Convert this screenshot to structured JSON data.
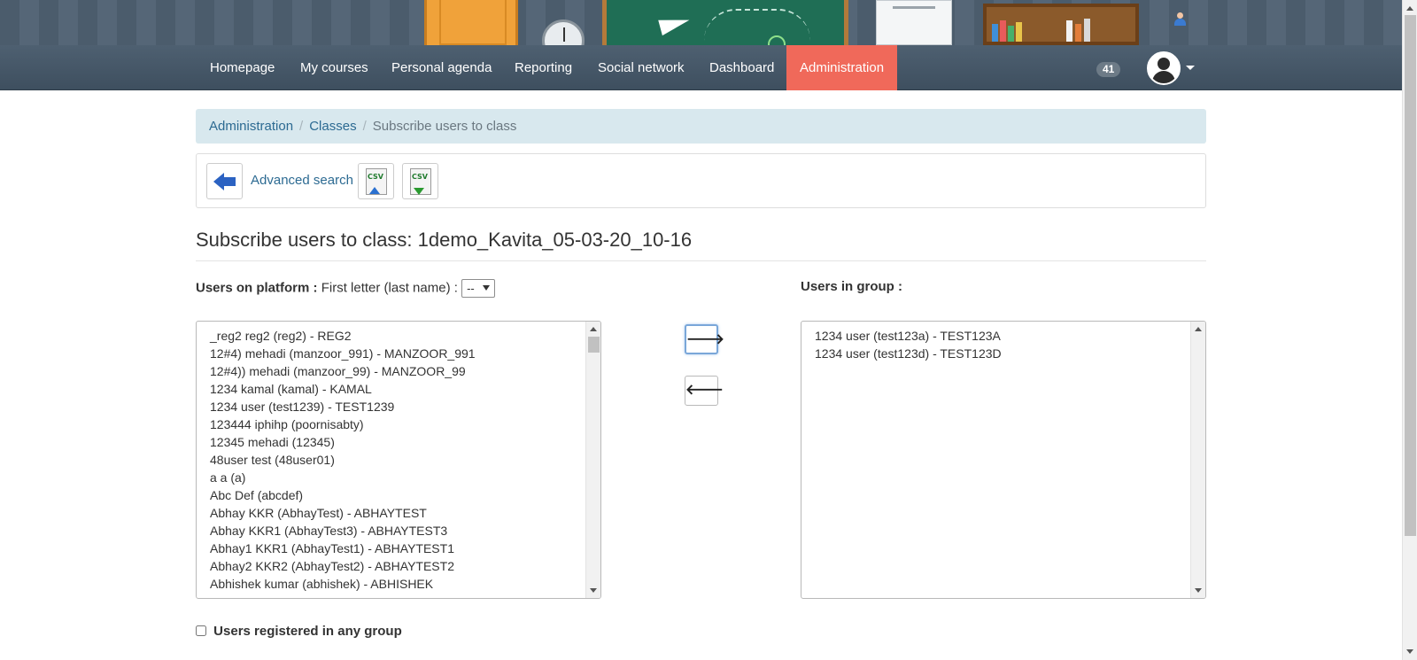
{
  "nav": {
    "items": [
      {
        "label": "Homepage"
      },
      {
        "label": "My courses"
      },
      {
        "label": "Personal agenda"
      },
      {
        "label": "Reporting"
      },
      {
        "label": "Social network"
      },
      {
        "label": "Dashboard"
      },
      {
        "label": "Administration",
        "active": true
      }
    ],
    "notification_count": "41",
    "active_color": "#f0695a"
  },
  "breadcrumb": {
    "items": [
      "Administration",
      "Classes"
    ],
    "current": "Subscribe users to class",
    "separator": "/"
  },
  "toolbar": {
    "back_icon": "back-arrow-icon",
    "advanced_search_label": "Advanced search",
    "import_csv_text": "CSV",
    "export_csv_text": "CSV"
  },
  "page": {
    "title": "Subscribe users to class: 1demo_Kavita_05-03-20_10-16"
  },
  "filters": {
    "users_on_platform_label": "Users on platform :",
    "first_letter_label": "First letter (last name) :",
    "first_letter_value": "--",
    "users_in_group_label": "Users in group :"
  },
  "platform_users": [
    "_reg2 reg2 (reg2) - REG2",
    "12#4) mehadi (manzoor_991) - MANZOOR_991",
    "12#4)) mehadi (manzoor_99) - MANZOOR_99",
    "1234 kamal (kamal) - KAMAL",
    "1234 user (test1239) - TEST1239",
    "123444 iphihp (poornisabty)",
    "12345 mehadi (12345)",
    "48user test (48user01)",
    "a a (a)",
    "Abc Def (abcdef)",
    "Abhay KKR (AbhayTest) - ABHAYTEST",
    "Abhay KKR1 (AbhayTest3) - ABHAYTEST3",
    "Abhay1 KKR1 (AbhayTest1) - ABHAYTEST1",
    "Abhay2 KKR2 (AbhayTest2) - ABHAYTEST2",
    "Abhishek kumar (abhishek) - ABHISHEK"
  ],
  "group_users": [
    "1234 user (test123a) - TEST123A",
    "1234 user (test123d) - TEST123D"
  ],
  "buttons": {
    "add_symbol": "🡒",
    "remove_symbol": "🡐"
  },
  "any_group": {
    "label": "Users registered in any group",
    "checked": false
  }
}
